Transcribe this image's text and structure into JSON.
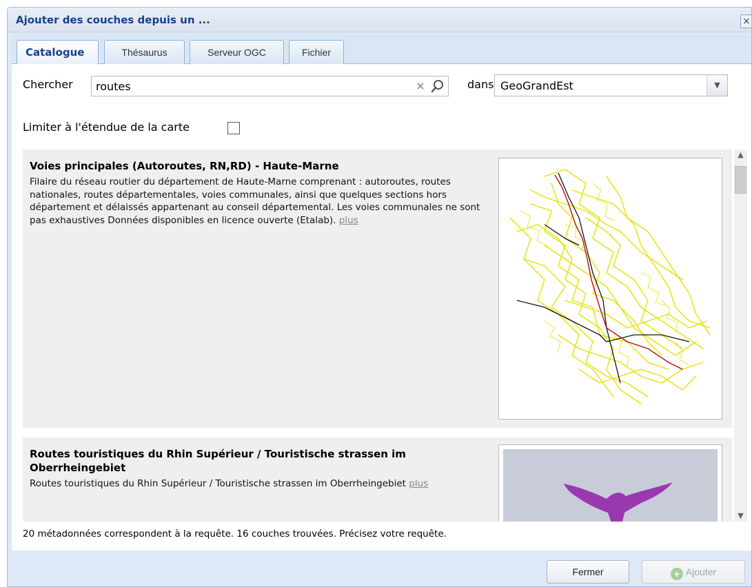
{
  "window": {
    "title": "Ajouter des couches depuis un ...",
    "close_icon": "close-icon"
  },
  "tabs": [
    {
      "label": "Catalogue",
      "active": true
    },
    {
      "label": "Thésaurus",
      "active": false
    },
    {
      "label": "Serveur OGC",
      "active": false
    },
    {
      "label": "Fichier",
      "active": false
    }
  ],
  "search": {
    "label": "Chercher",
    "value": "routes",
    "clear_icon": "clear-icon",
    "search_icon": "search-icon",
    "in_label": "dans",
    "catalog_selected": "GeoGrandEst"
  },
  "extent_filter": {
    "label": "Limiter à l'étendue de la carte",
    "checked": false
  },
  "results": [
    {
      "title": "Voies principales (Autoroutes, RN,RD) - Haute-Marne",
      "abstract": "Filaire du réseau routier du département de Haute-Marne comprenant : autoroutes, routes nationales, routes départementales, voies communales, ainsi que quelques sections hors département et délaissés appartenant au conseil départemental. Les voies communales ne sont pas exhaustives Données disponibles en licence ouverte (Etalab).",
      "more_label": "plus",
      "thumbnail": "road-network-map"
    },
    {
      "title": "Routes touristiques du Rhin Supérieur / Touristische strassen im Oberrheingebiet",
      "abstract": "Routes touristiques du Rhin Supérieur / Touristische strassen im Oberrheingebiet",
      "more_label": "plus",
      "thumbnail": "eagle-logo"
    }
  ],
  "status": "20 métadonnées correspondent à la requête. 16 couches trouvées. Précisez votre requête.",
  "buttons": {
    "close_label": "Fermer",
    "add_label": "Ajouter",
    "add_enabled": false
  },
  "colors": {
    "header_text": "#15428b",
    "frame_bg": "#dfe8f6",
    "frame_border": "#99bbe8",
    "record_bg": "#efefef",
    "road_yellow": "#e8e000",
    "road_black": "#111111",
    "road_red": "#b01010",
    "eagle_purple": "#9a38b0"
  }
}
